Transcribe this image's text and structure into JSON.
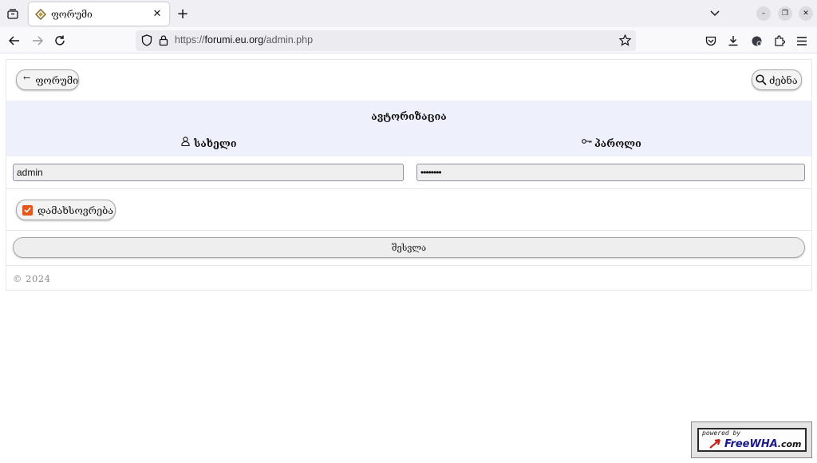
{
  "browser": {
    "tab_title": "ფორუმი",
    "url_prefix": "https://",
    "url_host": "forumi.eu.org",
    "url_path": "/admin.php"
  },
  "page": {
    "back_label": "ფორუმი",
    "search_label": "ძებნა",
    "auth_title": "ავტორიზაცია",
    "username_label": "სახელი",
    "password_label": "პაროლი",
    "username_value": "admin",
    "password_value": "••••••••",
    "remember_label": "დამახსოვრება",
    "remember_checked": true,
    "submit_label": "შესვლა",
    "footer": "© 2024"
  },
  "badge": {
    "powered_by": "powered by",
    "brand": "FreeWHA",
    "domain": ".com"
  },
  "colors": {
    "accent": "#e2571e",
    "auth_band": "#eef0fb"
  }
}
